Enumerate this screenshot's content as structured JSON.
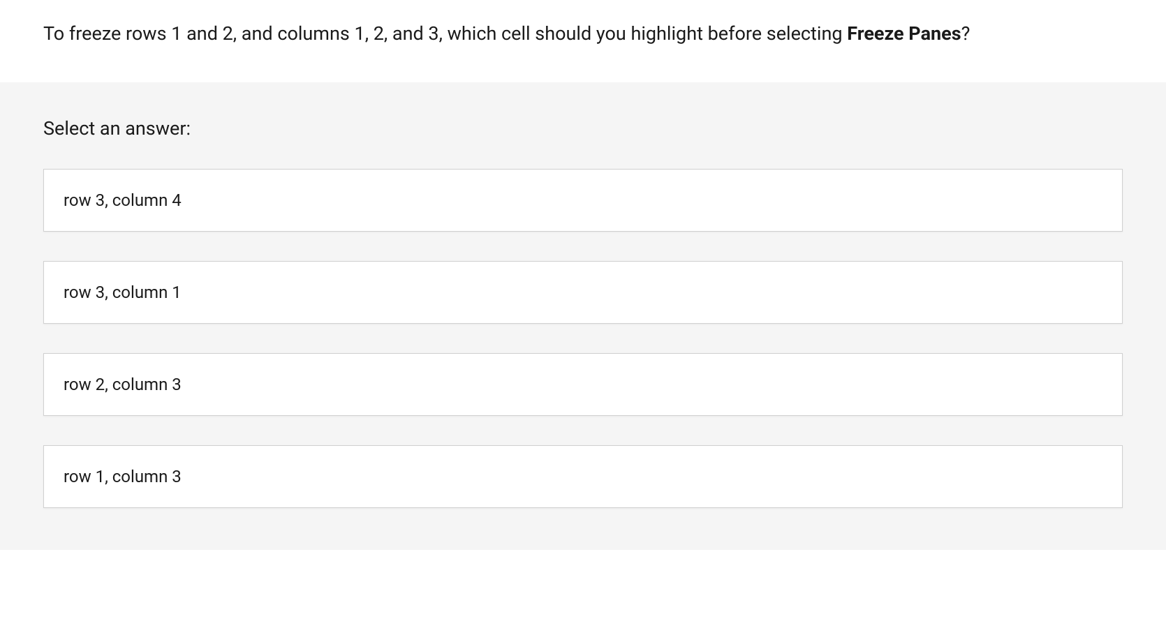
{
  "question": {
    "prefix": "To freeze rows 1 and 2, and columns 1, 2, and 3, which cell should you highlight before selecting ",
    "bold": "Freeze Panes",
    "suffix": "?"
  },
  "prompt": "Select an answer:",
  "options": [
    "row 3, column 4",
    "row 3, column 1",
    "row 2, column 3",
    "row 1, column 3"
  ]
}
